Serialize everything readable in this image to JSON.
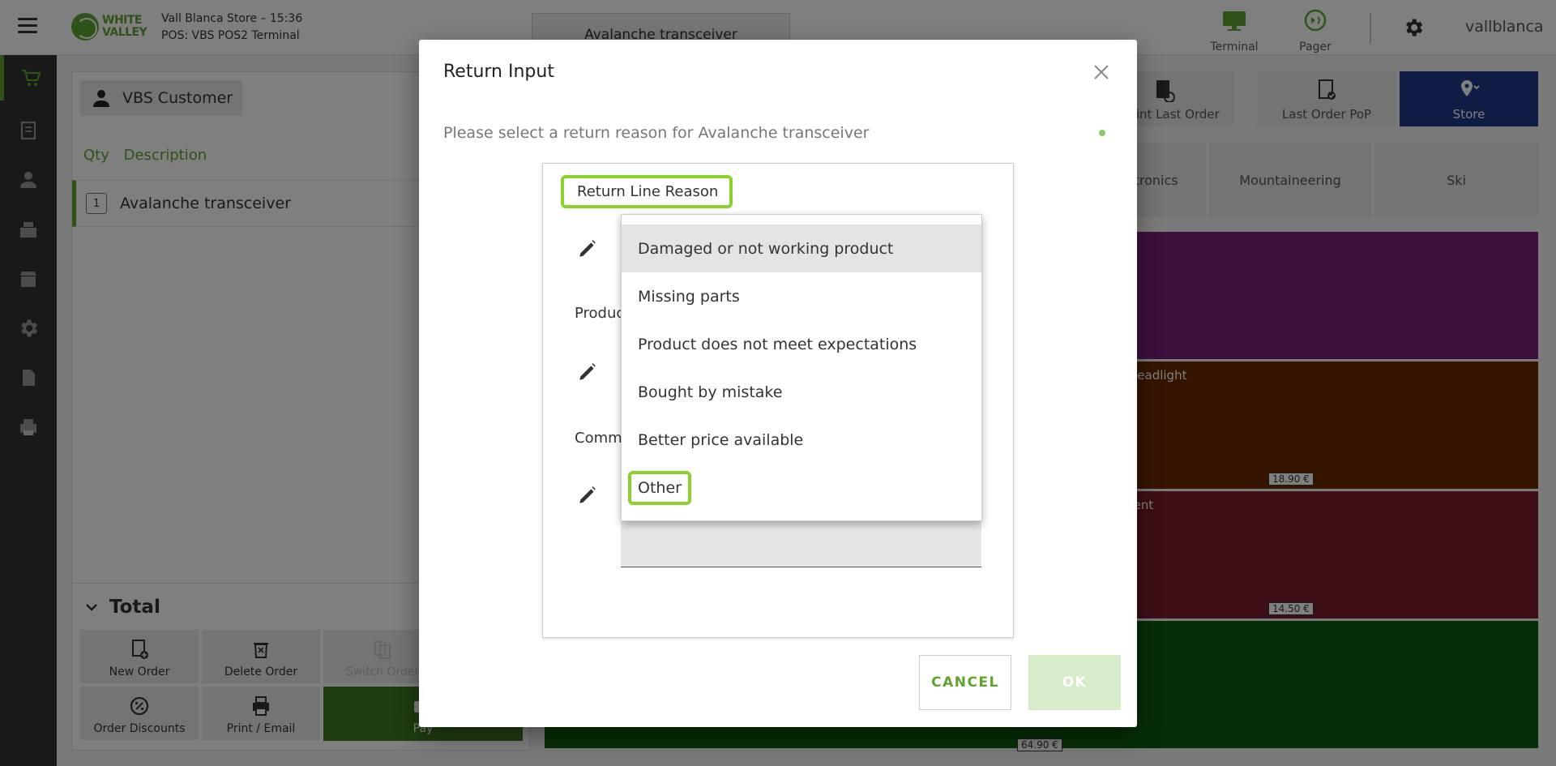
{
  "header": {
    "logo_line1": "WHITE",
    "logo_line2": "VALLEY",
    "store_line": "Vall Blanca Store – 15:36",
    "pos_line": "POS: VBS POS2 Terminal",
    "tab_title": "Avalanche transceiver",
    "terminal_label": "Terminal",
    "pager_label": "Pager",
    "username": "vallblanca"
  },
  "order": {
    "customer": "VBS Customer",
    "col_qty": "Qty",
    "col_description": "Description",
    "lines": [
      {
        "qty": "1",
        "description": "Avalanche transceiver"
      }
    ],
    "total_label": "Total",
    "actions": {
      "new_order": "New Order",
      "delete_order": "Delete Order",
      "switch_order": "Switch Order",
      "order_discounts": "Order Discounts",
      "print_email": "Print / Email",
      "pay": "Pay"
    }
  },
  "toolbar": {
    "reprint_last_order": "Reprint Last Order",
    "last_order_pop": "Last Order PoP",
    "store": "Store"
  },
  "categories": [
    "Electronics",
    "Mountaineering",
    "Ski"
  ],
  "tiles": [
    {
      "name": "",
      "price": "",
      "color": "#7a1f79"
    },
    {
      "name": "Headlight",
      "price": "18.90 €",
      "color": "#6b2a00"
    },
    {
      "name": "Tent",
      "price": "14.50 €",
      "color": "#7a1c2a"
    },
    {
      "name": "",
      "price": "64.90 €",
      "color": "#0d5c0d"
    }
  ],
  "dialog": {
    "title": "Return Input",
    "message": "Please select a return reason for Avalanche transceiver",
    "field_reason_label": "Return Line Reason",
    "field_product_label": "Product",
    "field_comment_label": "Comment",
    "options": [
      "Damaged or not working product",
      "Missing parts",
      "Product does not meet expectations",
      "Bought by mistake",
      "Better price available",
      "Other"
    ],
    "cancel_label": "CANCEL",
    "ok_label": "OK"
  },
  "colors": {
    "brand_green": "#5da52e",
    "highlight_green": "#8bd12e",
    "store_blue": "#1f3a8a",
    "nav_dark": "#333333"
  }
}
